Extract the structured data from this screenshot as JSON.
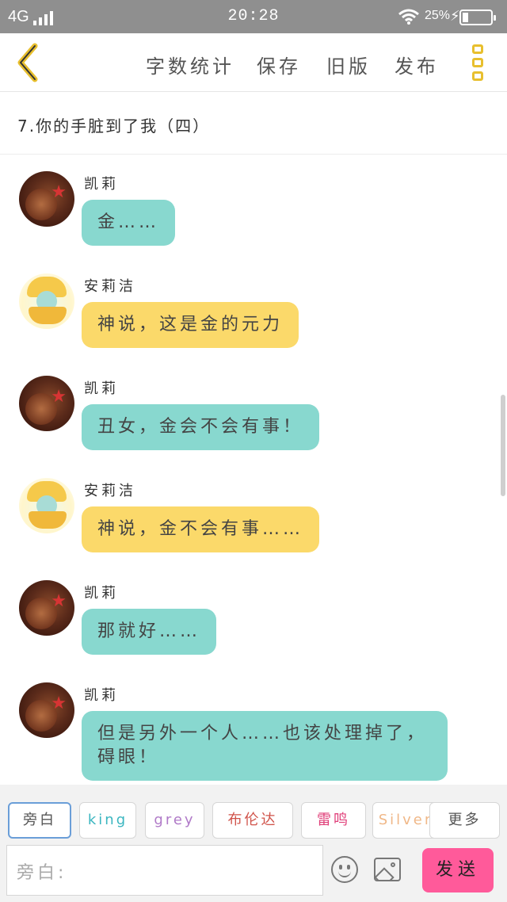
{
  "status_bar": {
    "network": "4G",
    "time": "20:28",
    "battery": "25%"
  },
  "toolbar": {
    "word_count": "字数统计",
    "save": "保存",
    "old_version": "旧版",
    "publish": "发布"
  },
  "chapter": {
    "title": "7.你的手脏到了我（四）"
  },
  "messages": [
    {
      "speaker": "凯莉",
      "text": "金……"
    },
    {
      "speaker": "安莉洁",
      "text": "神说，这是金的元力"
    },
    {
      "speaker": "凯莉",
      "text": "丑女，金会不会有事！"
    },
    {
      "speaker": "安莉洁",
      "text": "神说，金不会有事……"
    },
    {
      "speaker": "凯莉",
      "text": "那就好……"
    },
    {
      "speaker": "凯莉",
      "text": "但是另外一个人……也该处理掉了，碍眼！"
    }
  ],
  "roles": [
    {
      "label": "旁白",
      "color": "#555555"
    },
    {
      "label": "king",
      "color": "#3bb6c0"
    },
    {
      "label": "grey",
      "color": "#b07ac8"
    },
    {
      "label": "布伦达",
      "color": "#d0534a"
    },
    {
      "label": "雷鸣",
      "color": "#e0407a"
    },
    {
      "label": "Silver",
      "color": "#f0b888"
    },
    {
      "label": "更多",
      "color": "#555555"
    }
  ],
  "input": {
    "placeholder": "旁白:"
  },
  "send_button": {
    "label": "发送"
  },
  "colors": {
    "bubble_kelly": "#88d8cf",
    "bubble_angie": "#fbd96a",
    "send": "#ff5a9a",
    "accent": "#e8bf2e"
  }
}
